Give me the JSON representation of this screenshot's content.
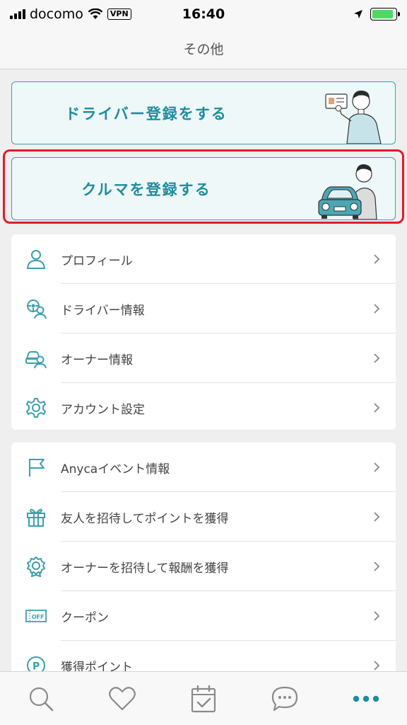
{
  "status": {
    "carrier": "docomo",
    "vpn": "VPN",
    "time": "16:40",
    "battery_level": 0.9,
    "battery_color": "#4cd964"
  },
  "nav": {
    "title": "その他"
  },
  "banners": {
    "driver_register": "ドライバー登録をする",
    "car_register": "クルマを登録する"
  },
  "colors": {
    "accent": "#1f8c9e",
    "highlight": "#e11c2a",
    "icon": "#3aa0ae"
  },
  "section1": [
    {
      "label": "プロフィール",
      "icon": "person-icon"
    },
    {
      "label": "ドライバー情報",
      "icon": "driver-icon"
    },
    {
      "label": "オーナー情報",
      "icon": "owner-icon"
    },
    {
      "label": "アカウント設定",
      "icon": "gear-icon"
    }
  ],
  "section2": [
    {
      "label": "Anycaイベント情報",
      "icon": "flag-icon"
    },
    {
      "label": "友人を招待してポイントを獲得",
      "icon": "gift-icon"
    },
    {
      "label": "オーナーを招待して報酬を獲得",
      "icon": "badge-icon"
    },
    {
      "label": "クーポン",
      "icon": "coupon-icon"
    },
    {
      "label": "獲得ポイント",
      "icon": "points-icon"
    }
  ],
  "tabs": [
    {
      "icon": "search-icon"
    },
    {
      "icon": "heart-icon"
    },
    {
      "icon": "calendar-check-icon"
    },
    {
      "icon": "chat-icon"
    },
    {
      "icon": "more-icon",
      "active": true
    }
  ]
}
